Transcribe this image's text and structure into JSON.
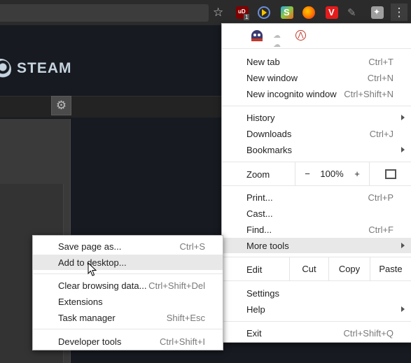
{
  "toolbar": {
    "star_icon": "star-icon",
    "extensions": [
      "ublock-icon",
      "media-player-icon",
      "skype-icon",
      "firefox-icon",
      "vivaldi-icon",
      "pen-icon",
      "puzzle-icon"
    ],
    "ublock_badge": "1",
    "menu_icon": "kebab-menu-icon"
  },
  "steam": {
    "logo_text": "STEAM"
  },
  "main_menu": {
    "extension_icons": [
      "ghost-icon",
      "clouds-icon",
      "compass-icon"
    ],
    "items": [
      {
        "label": "New tab",
        "shortcut": "Ctrl+T"
      },
      {
        "label": "New window",
        "shortcut": "Ctrl+N"
      },
      {
        "label": "New incognito window",
        "shortcut": "Ctrl+Shift+N"
      },
      {
        "label": "History",
        "shortcut": ""
      },
      {
        "label": "Downloads",
        "shortcut": "Ctrl+J"
      },
      {
        "label": "Bookmarks",
        "shortcut": ""
      },
      {
        "label": "Print...",
        "shortcut": "Ctrl+P"
      },
      {
        "label": "Cast...",
        "shortcut": ""
      },
      {
        "label": "Find...",
        "shortcut": "Ctrl+F"
      },
      {
        "label": "More tools",
        "shortcut": ""
      },
      {
        "label": "Settings",
        "shortcut": ""
      },
      {
        "label": "Help",
        "shortcut": ""
      },
      {
        "label": "Exit",
        "shortcut": "Ctrl+Shift+Q"
      }
    ],
    "zoom": {
      "label": "Zoom",
      "minus": "−",
      "value": "100%",
      "plus": "+"
    },
    "edit": {
      "label": "Edit",
      "cut": "Cut",
      "copy": "Copy",
      "paste": "Paste"
    }
  },
  "sub_menu": {
    "items": [
      {
        "label": "Save page as...",
        "shortcut": "Ctrl+S"
      },
      {
        "label": "Add to desktop...",
        "shortcut": ""
      },
      {
        "label": "Clear browsing data...",
        "shortcut": "Ctrl+Shift+Del"
      },
      {
        "label": "Extensions",
        "shortcut": ""
      },
      {
        "label": "Task manager",
        "shortcut": "Shift+Esc"
      },
      {
        "label": "Developer tools",
        "shortcut": "Ctrl+Shift+I"
      }
    ]
  },
  "colors": {
    "menu_bg": "#ffffff",
    "highlight": "#e8e8e8",
    "page_bg": "#171a21"
  }
}
